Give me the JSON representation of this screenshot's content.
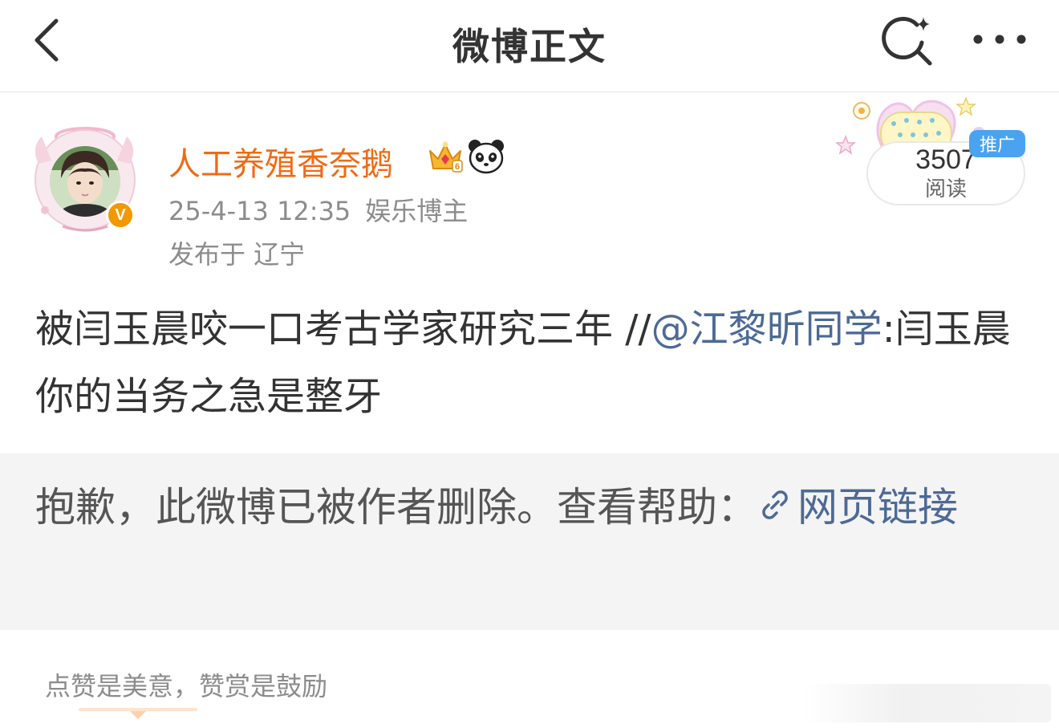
{
  "nav": {
    "title": "微博正文"
  },
  "user": {
    "name": "人工养殖香奈鹅",
    "verified_badge": "V",
    "date": "25-4-13 12:35",
    "role": "娱乐博主",
    "location": "发布于 辽宁"
  },
  "stats": {
    "read_count": "3507",
    "read_label": "阅读",
    "promo_label": "推广"
  },
  "post": {
    "text_prefix": "被闫玉晨咬一口考古学家研究三年 //",
    "mention": "@江黎昕同学",
    "text_suffix": ":闫玉晨你的当务之急是整牙"
  },
  "deleted": {
    "message": "抱歉，此微博已被作者删除。查看帮助：",
    "link_label": "网页链接"
  },
  "reward": {
    "hint": "点赞是美意，赞赏是鼓励"
  },
  "colors": {
    "username": "#ef6b14",
    "link": "#4d6a96",
    "meta": "#8c8c8c",
    "vip_badge": "#f39800",
    "promo": "#4aa3f0"
  },
  "icons": [
    "back-arrow-icon",
    "search-sparkle-icon",
    "more-dots-icon",
    "crown-icon",
    "panda-icon",
    "link-icon",
    "verified-v-icon"
  ]
}
